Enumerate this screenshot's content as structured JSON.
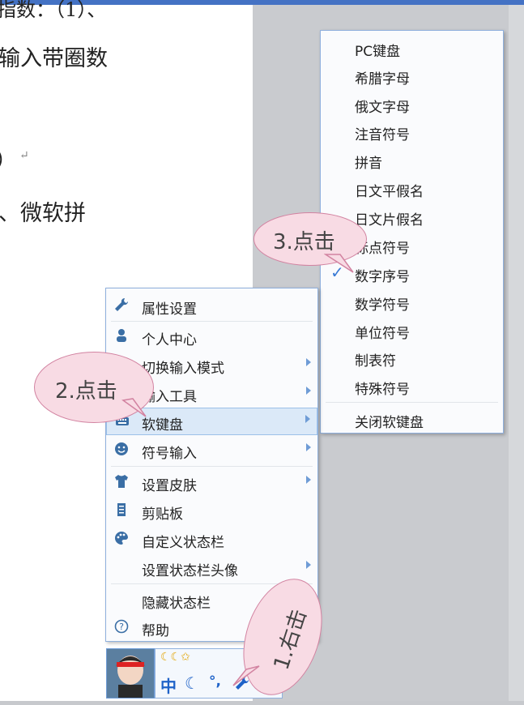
{
  "document": {
    "lines": [
      "输入带圈数",
      "）",
      "、微软拼"
    ],
    "top_fragment": "指数：（1）、",
    "paragraph_mark": "↵"
  },
  "context_menu": {
    "items": [
      {
        "label": "属性设置",
        "icon": "wrench-icon",
        "has_submenu": false
      },
      {
        "label": "个人中心",
        "icon": "person-icon",
        "has_submenu": false
      },
      {
        "label": "切换输入模式",
        "icon": "",
        "has_submenu": true
      },
      {
        "label": "输入工具",
        "icon": "tools-icon",
        "has_submenu": true
      },
      {
        "label": "软键盘",
        "icon": "keyboard-icon",
        "has_submenu": true,
        "highlighted": true
      },
      {
        "label": "符号输入",
        "icon": "smiley-icon",
        "has_submenu": true
      },
      {
        "label": "设置皮肤",
        "icon": "shirt-icon",
        "has_submenu": true
      },
      {
        "label": "剪贴板",
        "icon": "clipboard-icon",
        "has_submenu": false
      },
      {
        "label": "自定义状态栏",
        "icon": "palette-icon",
        "has_submenu": false
      },
      {
        "label": "设置状态栏头像",
        "icon": "",
        "has_submenu": true
      },
      {
        "label": "隐藏状态栏",
        "icon": "",
        "has_submenu": false
      },
      {
        "label": "帮助",
        "icon": "help-icon",
        "has_submenu": false
      }
    ]
  },
  "soft_keyboard_submenu": {
    "items": [
      {
        "label": "PC键盘"
      },
      {
        "label": "希腊字母"
      },
      {
        "label": "俄文字母"
      },
      {
        "label": "注音符号"
      },
      {
        "label": "拼音"
      },
      {
        "label": "日文平假名"
      },
      {
        "label": "日文片假名"
      },
      {
        "label": "标点符号"
      },
      {
        "label": "数字序号",
        "checked": true
      },
      {
        "label": "数学符号"
      },
      {
        "label": "单位符号"
      },
      {
        "label": "制表符"
      },
      {
        "label": "特殊符号"
      },
      {
        "label": "关闭软键盘"
      }
    ]
  },
  "callouts": {
    "step1": "1.右击",
    "step2": "2.点击",
    "step3": "3.点击"
  },
  "statusbar": {
    "mode": "中",
    "moon": "☾",
    "punct": "°,",
    "top_icons": "☾☾✩"
  },
  "colors": {
    "accent_blue": "#3a7bd5",
    "highlight_bg": "#dbe9f8",
    "bubble_fill": "#f8dbe4",
    "bubble_border": "#d283a1"
  }
}
